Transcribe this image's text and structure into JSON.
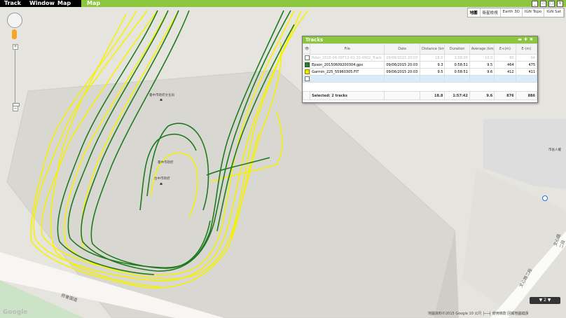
{
  "menu": {
    "track": "Track",
    "window": "Window",
    "map": "Map"
  },
  "map_types": [
    "地圖",
    "衛星檢視",
    "Earth 3D",
    "IGN Topo",
    "IGN Sat"
  ],
  "map_labels": {
    "place1": "臺中市政府文化局",
    "place2": "臺中市政府",
    "place3": "台中市政府",
    "place4": "市長人權",
    "road1": "文心路二段",
    "road2": "文心路二段",
    "road3": "府會園道"
  },
  "panel": {
    "title": "Tracks",
    "columns": [
      "File",
      "Date",
      "Distance (km)",
      "Duration",
      "Average (km/h)",
      "E+(m)",
      "E-(m)"
    ],
    "rows": [
      {
        "file": "Polar_2015-06-09T12-02-33-0902_Track",
        "date": "09/06/2015 20:03",
        "distance": "18.0",
        "duration": "1:58:00",
        "avg": "10.0",
        "eplus": "80",
        "eminus": "64",
        "state": "dim"
      },
      {
        "file": "Epson_20150609200304.gpx",
        "date": "09/06/2015 20:03",
        "distance": "9.3",
        "duration": "0:58:51",
        "avg": "9.5",
        "eplus": "464",
        "eminus": "475",
        "state": "on"
      },
      {
        "file": "Garmin_225_55960305.FIT",
        "date": "09/06/2015 20:03",
        "distance": "9.5",
        "duration": "0:58:51",
        "avg": "9.6",
        "eplus": "412",
        "eminus": "411",
        "state": "on-y"
      }
    ],
    "footer": {
      "label": "Selected: 2 tracks",
      "distance": "18.8",
      "duration": "1:57:42",
      "avg": "9.6",
      "eplus": "876",
      "eminus": "886"
    }
  },
  "attribution": "地圖資料©2015 Google   10 公尺 ├──┤   使用條款   回報地圖錯誤",
  "google_logo": "Google",
  "colors": {
    "green_track": "#1f7a1f",
    "yellow_track": "#f5f20a",
    "accent": "#8cc63f",
    "building": "#d9d7d2",
    "ground": "#e6e4df"
  }
}
